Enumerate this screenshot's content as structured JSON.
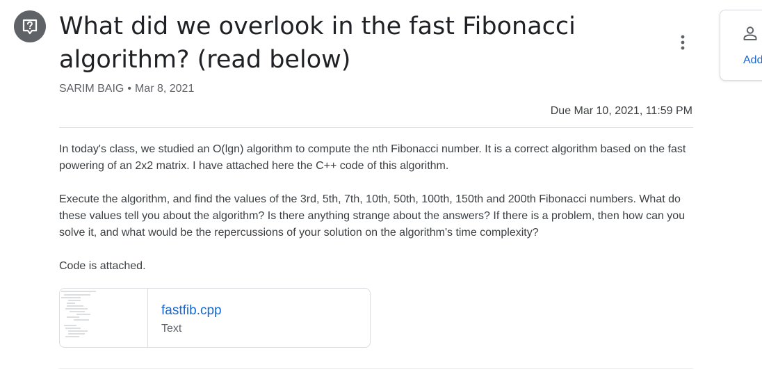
{
  "post": {
    "title": "What did we overlook in the fast Fibonacci algorithm? (read below)",
    "author": "SARIM BAIG",
    "separator": "•",
    "date": "Mar 8, 2021",
    "due": "Due Mar 10, 2021, 11:59 PM",
    "paragraphs": [
      "In today's class, we studied an O(lgn) algorithm to compute the nth Fibonacci number. It is a correct algorithm based on the fast powering of an 2x2 matrix. I have attached here the C++ code of this algorithm.",
      "Execute the algorithm, and find the values of the 3rd, 5th, 7th, 10th, 50th, 100th, 150th and 200th Fibonacci numbers. What do these values tell you about the algorithm? Is there anything strange about the answers? If there is a problem, then how can you solve it, and what would be the repercussions of your solution on the algorithm's time complexity?",
      "Code is attached."
    ]
  },
  "attachment": {
    "filename": "fastfib.cpp",
    "type": "Text"
  },
  "side_card": {
    "label": "Add"
  },
  "icons": {
    "question": "question-icon",
    "more": "more-vert-icon",
    "person": "person-icon"
  },
  "colors": {
    "link": "#1967d2",
    "avatar": "#5f6368",
    "divider": "#dadce0"
  }
}
